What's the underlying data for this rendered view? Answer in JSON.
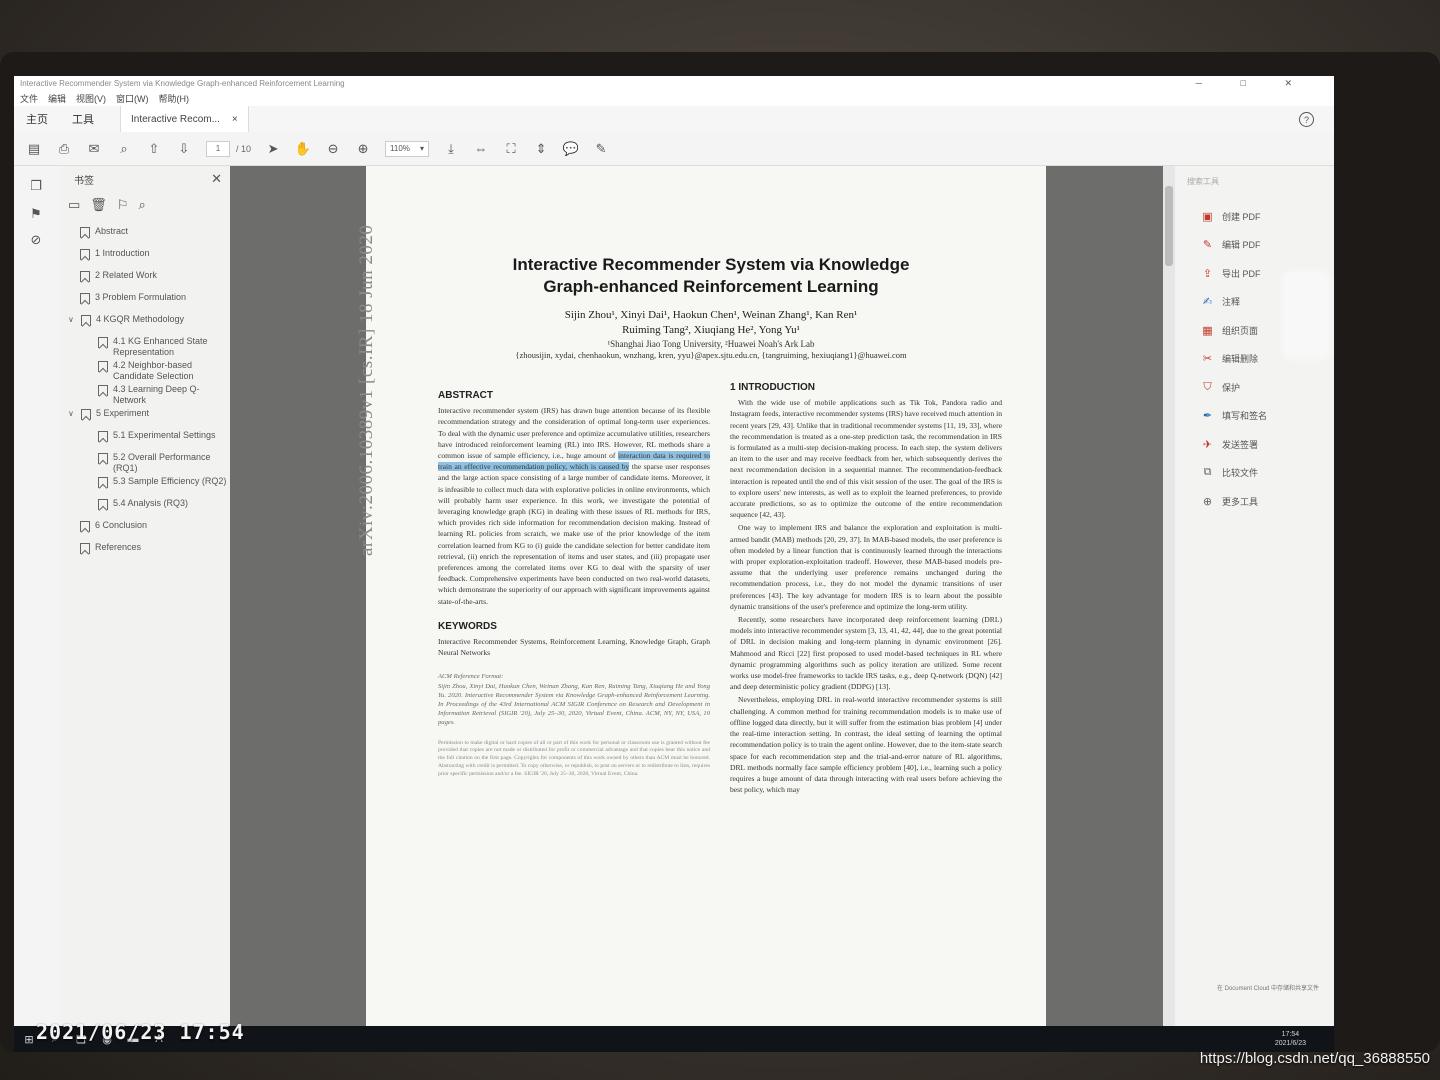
{
  "photo": {
    "timestamp": "2021/06/23 17:54",
    "watermark": "https://blog.csdn.net/qq_36888550"
  },
  "window": {
    "title": "Interactive Recommender System via Knowledge Graph-enhanced Reinforcement Learning"
  },
  "menu": [
    "文件",
    "编辑",
    "视图(V)",
    "窗口(W)",
    "帮助(H)"
  ],
  "tabs": {
    "home": "主页",
    "tools": "工具",
    "document": "Interactive Recom...",
    "close": "×"
  },
  "toolbar": {
    "page_current": "1",
    "page_total": "/ 10",
    "zoom": "110%"
  },
  "bookmarks": {
    "header": "书签",
    "items": [
      {
        "label": "Abstract",
        "level": 0
      },
      {
        "label": "1 Introduction",
        "level": 0
      },
      {
        "label": "2 Related Work",
        "level": 0
      },
      {
        "label": "3 Problem Formulation",
        "level": 0
      },
      {
        "label": "4 KGQR Methodology",
        "level": 0,
        "expanded": true
      },
      {
        "label": "4.1 KG Enhanced State Representation",
        "level": 1
      },
      {
        "label": "4.2 Neighbor-based Candidate Selection",
        "level": 1
      },
      {
        "label": "4.3 Learning Deep Q-Network",
        "level": 1
      },
      {
        "label": "5 Experiment",
        "level": 0,
        "expanded": true
      },
      {
        "label": "5.1 Experimental Settings",
        "level": 1
      },
      {
        "label": "5.2 Overall Performance (RQ1)",
        "level": 1
      },
      {
        "label": "5.3 Sample Efficiency (RQ2)",
        "level": 1
      },
      {
        "label": "5.4 Analysis (RQ3)",
        "level": 1
      },
      {
        "label": "6 Conclusion",
        "level": 0
      },
      {
        "label": "References",
        "level": 0
      }
    ]
  },
  "paper": {
    "title_line1": "Interactive Recommender System via Knowledge",
    "title_line2": "Graph-enhanced Reinforcement Learning",
    "authors_line1": "Sijin Zhou¹, Xinyi Dai¹, Haokun Chen¹, Weinan Zhang¹, Kan Ren¹",
    "authors_line2": "Ruiming Tang², Xiuqiang He², Yong Yu¹",
    "affiliation": "¹Shanghai Jiao Tong University, ²Huawei Noah's Ark Lab",
    "emails": "{zhousijin, xydai, chenhaokun, wnzhang, kren, yyu}@apex.sjtu.edu.cn, {tangruiming, hexiuqiang1}@huawei.com",
    "arxiv_id": "arXiv:2006.10389v1  [cs.IR]  18 Jun 2020",
    "abstract_heading": "ABSTRACT",
    "abstract_before": "Interactive recommender system (IRS) has drawn huge attention because of its flexible recommendation strategy and the consideration of optimal long-term user experiences. To deal with the dynamic user preference and optimize accumulative utilities, researchers have introduced reinforcement learning (RL) into IRS. However, RL methods share a common issue of sample efficiency, i.e., huge amount of ",
    "abstract_highlight": "interaction data is required to train an effective recommendation policy, which is caused by",
    "abstract_after": " the sparse user responses and the large action space consisting of a large number of candidate items. Moreover, it is infeasible to collect much data with explorative policies in online environments, which will probably harm user experience. In this work, we investigate the potential of leveraging knowledge graph (KG) in dealing with these issues of RL methods for IRS, which provides rich side information for recommendation decision making. Instead of learning RL policies from scratch, we make use of the prior knowledge of the item correlation learned from KG to (i) guide the candidate selection for better candidate item retrieval, (ii) enrich the representation of items and user states, and (iii) propagate user preferences among the correlated items over KG to deal with the sparsity of user feedback. Comprehensive experiments have been conducted on two real-world datasets, which demonstrate the superiority of our approach with significant improvements against state-of-the-arts.",
    "keywords_heading": "KEYWORDS",
    "keywords": "Interactive Recommender Systems, Reinforcement Learning, Knowledge Graph, Graph Neural Networks",
    "acm_format_heading": "ACM Reference Format:",
    "acm_format": "Sijin Zhou, Xinyi Dai, Haokun Chen, Weinan Zhang, Kan Ren, Ruiming Tang, Xiuqiang He and Yong Yu. 2020. Interactive Recommender System via Knowledge Graph-enhanced Reinforcement Learning. In Proceedings of the 43rd International ACM SIGIR Conference on Research and Development in Information Retrieval (SIGIR '20), July 25–30, 2020, Virtual Event, China. ACM, NY, NY, USA, 10 pages.",
    "permission": "Permission to make digital or hard copies of all or part of this work for personal or classroom use is granted without fee provided that copies are not made or distributed for profit or commercial advantage and that copies bear this notice and the full citation on the first page. Copyrights for components of this work owned by others than ACM must be honored. Abstracting with credit is permitted. To copy otherwise, or republish, to post on servers or to redistribute to lists, requires prior specific permission and/or a fee. SIGIR '20, July 25–30, 2020, Virtual Event, China.",
    "intro_heading": "1   INTRODUCTION",
    "intro_p1": "With the wide use of mobile applications such as Tik Tok, Pandora radio and Instagram feeds, interactive recommender systems (IRS) have received much attention in recent years [29, 43]. Unlike that in traditional recommender systems [11, 19, 33], where the recommendation is treated as a one-step prediction task, the recommendation in IRS is formulated as a multi-step decision-making process. In each step, the system delivers an item to the user and may receive feedback from her, which subsequently derives the next recommendation decision in a sequential manner. The recommendation-feedback interaction is repeated until the end of this visit session of the user. The goal of the IRS is to explore users' new interests, as well as to exploit the learned preferences, to provide accurate predictions, so as to optimize the outcome of the entire recommendation sequence [42, 43].",
    "intro_p2": "One way to implement IRS and balance the exploration and exploitation is multi-armed bandit (MAB) methods [20, 29, 37]. In MAB-based models, the user preference is often modeled by a linear function that is continuously learned through the interactions with proper exploration-exploitation tradeoff. However, these MAB-based models pre-assume that the underlying user preference remains unchanged during the recommendation process, i.e., they do not model the dynamic transitions of user preferences [43]. The key advantage for modern IRS is to learn about the possible dynamic transitions of the user's preference and optimize the long-term utility.",
    "intro_p3": "Recently, some researchers have incorporated deep reinforcement learning (DRL) models into interactive recommender system [3, 13, 41, 42, 44], due to the great potential of DRL in decision making and long-term planning in dynamic environment [26]. Mahmood and Ricci [22] first proposed to used model-based techniques in RL where dynamic programming algorithms such as policy iteration are utilized. Some recent works use model-free frameworks to tackle IRS tasks, e.g., deep Q-network (DQN) [42] and deep deterministic policy gradient (DDPG) [13].",
    "intro_p4": "Nevertheless, employing DRL in real-world interactive recommender systems is still challenging. A common method for training recommendation models is to make use of offline logged data directly, but it will suffer from the estimation bias problem [4] under the real-time interaction setting. In contrast, the ideal setting of learning the optimal recommendation policy is to train the agent online. However, due to the item-state search space for each recommendation step and the trial-and-error nature of RL algorithms, DRL methods normally face sample efficiency problem [40], i.e., learning such a policy requires a huge amount of data through interacting with real users before achieving the best policy, which may"
  },
  "right_panel": {
    "search": "搜索工具",
    "items": [
      {
        "icon": "pdf-create-icon",
        "label": "创建 PDF"
      },
      {
        "icon": "pdf-edit-icon",
        "label": "编辑 PDF"
      },
      {
        "icon": "pdf-export-icon",
        "label": "导出 PDF"
      },
      {
        "icon": "comment-icon",
        "label": "注释"
      },
      {
        "icon": "organize-icon",
        "label": "组织页面"
      },
      {
        "icon": "redact-icon",
        "label": "编辑删除"
      },
      {
        "icon": "protect-icon",
        "label": "保护"
      },
      {
        "icon": "sign-icon",
        "label": "填写和签名"
      },
      {
        "icon": "send-icon",
        "label": "发送签署"
      },
      {
        "icon": "compare-icon",
        "label": "比较文件"
      },
      {
        "icon": "more-tools-icon",
        "label": "更多工具"
      }
    ],
    "footer": "在 Document Cloud 中存储和共享文件"
  },
  "taskbar": {
    "time": "17:54",
    "date": "2021/6/23"
  },
  "colors": {
    "highlight": "#8fc1e3",
    "doc_bg": "#6d6d6b",
    "accent_red": "#c0392b"
  }
}
